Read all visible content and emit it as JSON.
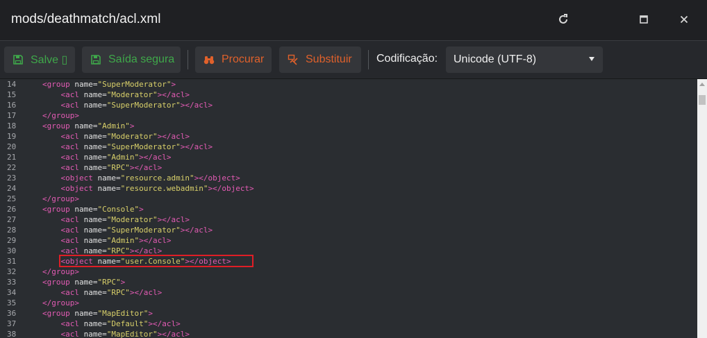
{
  "window": {
    "title": "mods/deathmatch/acl.xml",
    "controls": [
      "refresh-icon",
      "maximize-icon",
      "close-icon"
    ]
  },
  "toolbar": {
    "save_label": "Salve ▯",
    "save_exit_label": "Saída segura",
    "find_label": "Procurar",
    "replace_label": "Substituir",
    "encoding_label": "Codificação:",
    "encoding_value": "Unicode (UTF-8)",
    "colors": {
      "save": "#3fa84a",
      "search": "#e0612b"
    }
  },
  "editor": {
    "lines": [
      {
        "n": "14",
        "indent": 1,
        "tag": "group",
        "name": "SuperModerator",
        "close": false,
        "self": false
      },
      {
        "n": "15",
        "indent": 2,
        "tag": "acl",
        "name": "Moderator",
        "close": false,
        "self": true
      },
      {
        "n": "16",
        "indent": 2,
        "tag": "acl",
        "name": "SuperModerator",
        "close": false,
        "self": true
      },
      {
        "n": "17",
        "indent": 1,
        "tag": "group",
        "close": true
      },
      {
        "n": "18",
        "indent": 1,
        "tag": "group",
        "name": "Admin",
        "close": false,
        "self": false
      },
      {
        "n": "19",
        "indent": 2,
        "tag": "acl",
        "name": "Moderator",
        "close": false,
        "self": true
      },
      {
        "n": "20",
        "indent": 2,
        "tag": "acl",
        "name": "SuperModerator",
        "close": false,
        "self": true
      },
      {
        "n": "21",
        "indent": 2,
        "tag": "acl",
        "name": "Admin",
        "close": false,
        "self": true
      },
      {
        "n": "22",
        "indent": 2,
        "tag": "acl",
        "name": "RPC",
        "close": false,
        "self": true
      },
      {
        "n": "23",
        "indent": 2,
        "tag": "object",
        "name": "resource.admin",
        "close": false,
        "self": true
      },
      {
        "n": "24",
        "indent": 2,
        "tag": "object",
        "name": "resource.webadmin",
        "close": false,
        "self": true
      },
      {
        "n": "25",
        "indent": 1,
        "tag": "group",
        "close": true
      },
      {
        "n": "26",
        "indent": 1,
        "tag": "group",
        "name": "Console",
        "close": false,
        "self": false
      },
      {
        "n": "27",
        "indent": 2,
        "tag": "acl",
        "name": "Moderator",
        "close": false,
        "self": true
      },
      {
        "n": "28",
        "indent": 2,
        "tag": "acl",
        "name": "SuperModerator",
        "close": false,
        "self": true
      },
      {
        "n": "29",
        "indent": 2,
        "tag": "acl",
        "name": "Admin",
        "close": false,
        "self": true
      },
      {
        "n": "30",
        "indent": 2,
        "tag": "acl",
        "name": "RPC",
        "close": false,
        "self": true
      },
      {
        "n": "31",
        "indent": 2,
        "tag": "object",
        "name": "user.Console",
        "close": false,
        "self": true,
        "highlight": true
      },
      {
        "n": "32",
        "indent": 1,
        "tag": "group",
        "close": true
      },
      {
        "n": "33",
        "indent": 1,
        "tag": "group",
        "name": "RPC",
        "close": false,
        "self": false
      },
      {
        "n": "34",
        "indent": 2,
        "tag": "acl",
        "name": "RPC",
        "close": false,
        "self": true
      },
      {
        "n": "35",
        "indent": 1,
        "tag": "group",
        "close": true
      },
      {
        "n": "36",
        "indent": 1,
        "tag": "group",
        "name": "MapEditor",
        "close": false,
        "self": false
      },
      {
        "n": "37",
        "indent": 2,
        "tag": "acl",
        "name": "Default",
        "close": false,
        "self": true
      },
      {
        "n": "38",
        "indent": 2,
        "tag": "acl",
        "name": "MapEditor",
        "close": false,
        "self": true
      }
    ],
    "syntax_colors": {
      "tag": "#e35bb4",
      "attr": "#e0e0e0",
      "string": "#d9d06a",
      "line_number": "#a7a9ad"
    },
    "highlight_color": "#e01e26"
  }
}
